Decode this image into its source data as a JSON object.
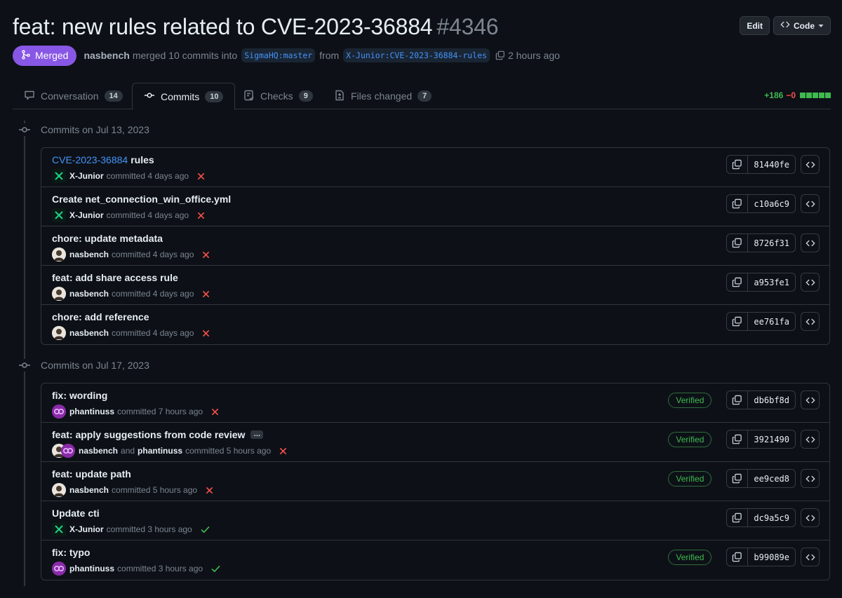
{
  "pr": {
    "title": "feat: new rules related to CVE-2023-36884",
    "number": "#4346",
    "state": "Merged",
    "author": "nasbench",
    "merge_text": "merged 10 commits into",
    "base_branch": "SigmaHQ:master",
    "from_text": "from",
    "head_branch": "X-Junior:CVE-2023-36884-rules",
    "time": "2 hours ago"
  },
  "header_actions": {
    "edit": "Edit",
    "code": "Code"
  },
  "tabs": [
    {
      "label": "Conversation",
      "count": "14",
      "icon": "comment-icon"
    },
    {
      "label": "Commits",
      "count": "10",
      "icon": "commit-icon"
    },
    {
      "label": "Checks",
      "count": "9",
      "icon": "checklist-icon"
    },
    {
      "label": "Files changed",
      "count": "7",
      "icon": "file-diff-icon"
    }
  ],
  "diffstat": {
    "additions": "+186",
    "deletions": "−0"
  },
  "groups": [
    {
      "heading": "Commits on Jul 13, 2023",
      "commits": [
        {
          "title_link": "CVE-2023-36884",
          "title": "rules",
          "authors": [
            "X-Junior"
          ],
          "time": "committed 4 days ago",
          "status": "fail",
          "verified": "",
          "sha": "81440fe"
        },
        {
          "title_link": "",
          "title": "Create net_connection_win_office.yml",
          "authors": [
            "X-Junior"
          ],
          "time": "committed 4 days ago",
          "status": "fail",
          "verified": "",
          "sha": "c10a6c9"
        },
        {
          "title_link": "",
          "title": "chore: update metadata",
          "authors": [
            "nasbench"
          ],
          "time": "committed 4 days ago",
          "status": "fail",
          "verified": "",
          "sha": "8726f31"
        },
        {
          "title_link": "",
          "title": "feat: add share access rule",
          "authors": [
            "nasbench"
          ],
          "time": "committed 4 days ago",
          "status": "fail",
          "verified": "",
          "sha": "a953fe1"
        },
        {
          "title_link": "",
          "title": "chore: add reference",
          "authors": [
            "nasbench"
          ],
          "time": "committed 4 days ago",
          "status": "fail",
          "verified": "",
          "sha": "ee761fa"
        }
      ]
    },
    {
      "heading": "Commits on Jul 17, 2023",
      "commits": [
        {
          "title_link": "",
          "title": "fix: wording",
          "authors": [
            "phantinuss"
          ],
          "time": "committed 7 hours ago",
          "status": "fail",
          "verified": "Verified",
          "sha": "db6bf8d"
        },
        {
          "title_link": "",
          "title": "feat: apply suggestions from code review",
          "authors": [
            "nasbench",
            "phantinuss"
          ],
          "and_text": "and",
          "time": "committed 5 hours ago",
          "status": "fail",
          "verified": "Verified",
          "sha": "3921490",
          "ellipsis": "…"
        },
        {
          "title_link": "",
          "title": "feat: update path",
          "authors": [
            "nasbench"
          ],
          "time": "committed 5 hours ago",
          "status": "fail",
          "verified": "Verified",
          "sha": "ee9ced8"
        },
        {
          "title_link": "",
          "title": "Update cti",
          "authors": [
            "X-Junior"
          ],
          "time": "committed 3 hours ago",
          "status": "success",
          "verified": "",
          "sha": "dc9a5c9"
        },
        {
          "title_link": "",
          "title": "fix: typo",
          "authors": [
            "phantinuss"
          ],
          "time": "committed 3 hours ago",
          "status": "success",
          "verified": "Verified",
          "sha": "b99089e"
        }
      ]
    }
  ],
  "colors": {
    "merged": "#8957e5",
    "success": "#3fb950",
    "fail": "#f85149",
    "link": "#4493f8",
    "background": "#0d1117"
  }
}
